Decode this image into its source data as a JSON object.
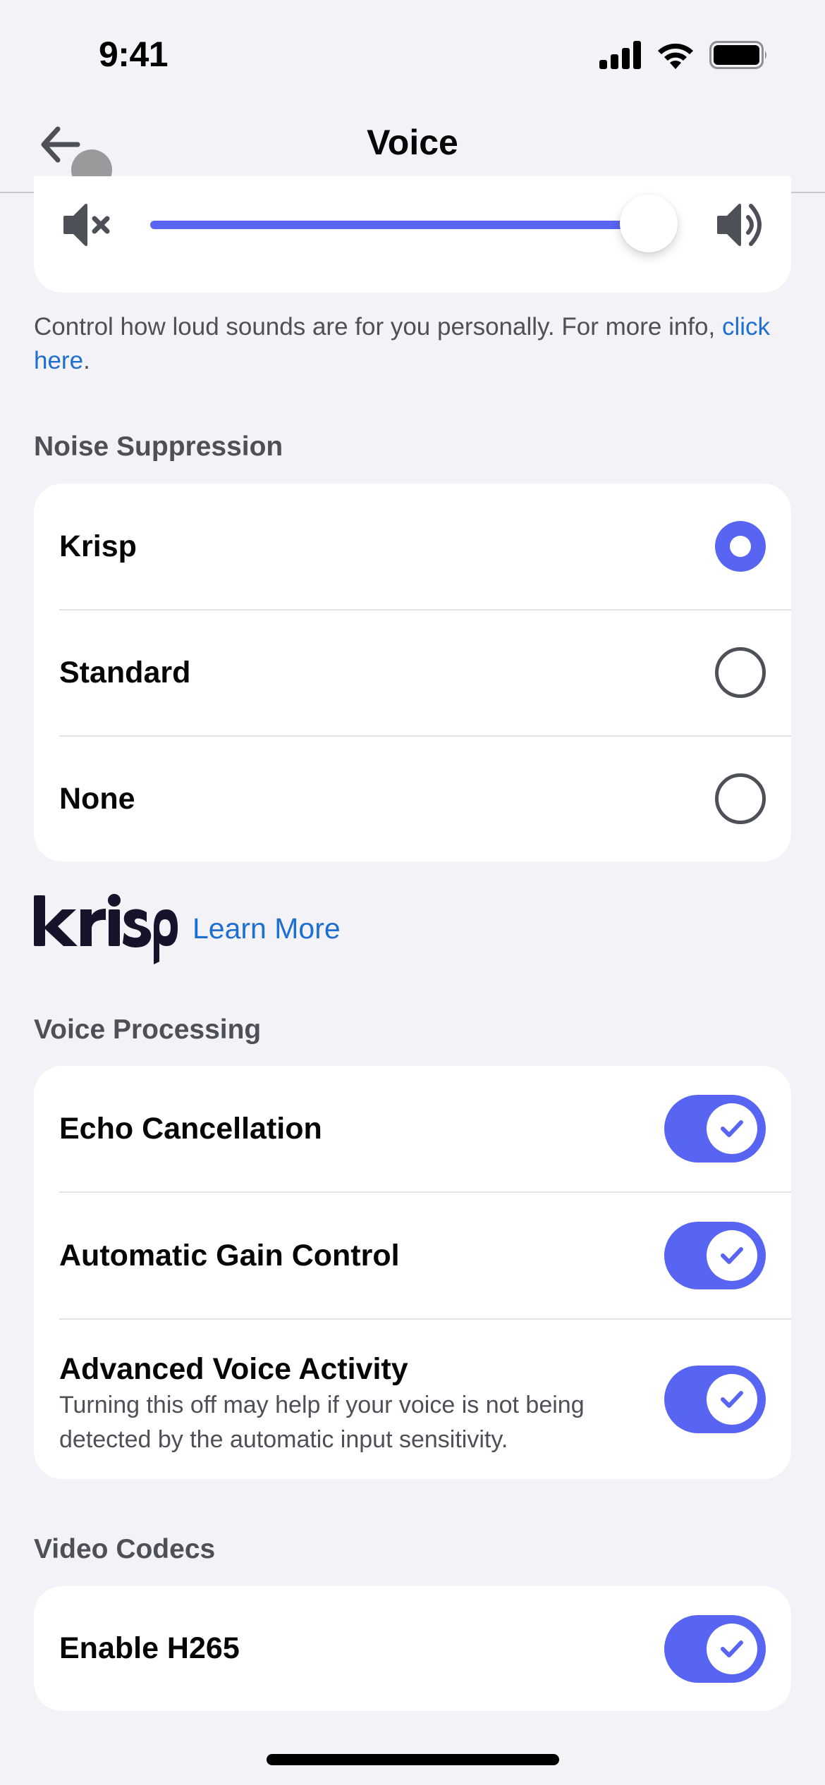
{
  "status_bar": {
    "time": "9:41",
    "icons": [
      "cellular-signal-icon",
      "wifi-icon",
      "battery-icon"
    ]
  },
  "header": {
    "title": "Voice",
    "back_icon": "arrow-left-icon"
  },
  "output_volume": {
    "min_icon": "speaker-muted-icon",
    "max_icon": "speaker-loud-icon",
    "value_percent": 100,
    "helper_text": "Control how loud sounds are for you personally. For more info, ",
    "helper_link": "click here",
    "helper_end": "."
  },
  "noise_suppression": {
    "header": "Noise Suppression",
    "options": [
      {
        "label": "Krisp",
        "selected": true
      },
      {
        "label": "Standard",
        "selected": false
      },
      {
        "label": "None",
        "selected": false
      }
    ],
    "brand": "krisp",
    "learn_more": "Learn More"
  },
  "voice_processing": {
    "header": "Voice Processing",
    "items": [
      {
        "label": "Echo Cancellation",
        "enabled": true
      },
      {
        "label": "Automatic Gain Control",
        "enabled": true
      },
      {
        "label": "Advanced Voice Activity",
        "subtitle": "Turning this off may help if your voice is not being detected by the automatic input sensitivity.",
        "enabled": true
      }
    ]
  },
  "video_codecs": {
    "header": "Video Codecs",
    "items": [
      {
        "label": "Enable H265",
        "enabled": true
      }
    ]
  },
  "colors": {
    "accent": "#5865F2",
    "link": "#1E6FD0",
    "background": "#F2F2F7",
    "card": "#FFFFFF",
    "text_primary": "#060607",
    "text_secondary": "#4E5058",
    "krisp_brand": "#16132B"
  }
}
